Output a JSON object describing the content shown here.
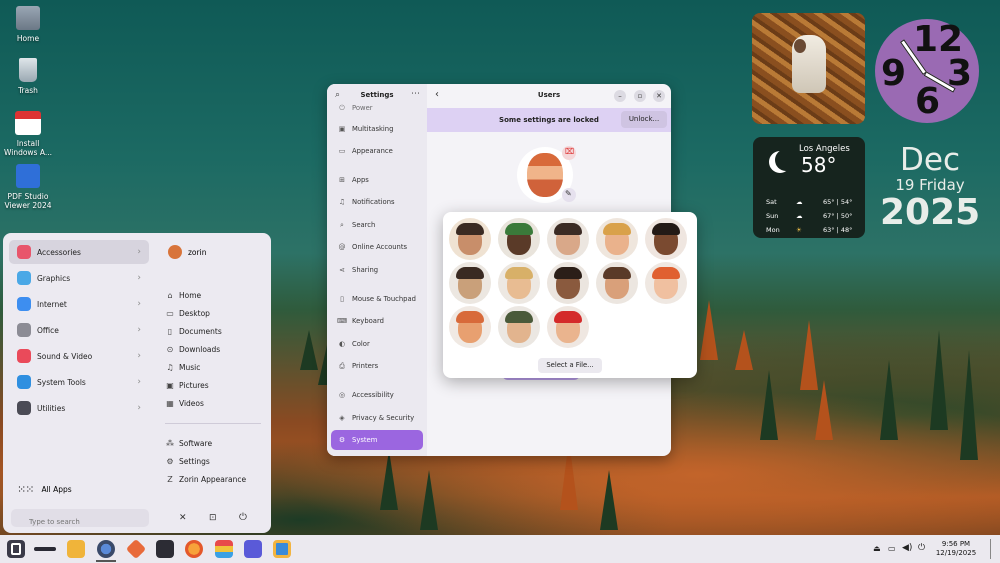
{
  "desktop": {
    "icons": [
      {
        "label": "Home"
      },
      {
        "label": "Trash"
      },
      {
        "label": "Install Windows A..."
      },
      {
        "label": "PDF Studio Viewer 2024"
      }
    ]
  },
  "widgets": {
    "clock": {
      "n12": "12",
      "n3": "3",
      "n6": "6",
      "n9": "9"
    },
    "weather": {
      "city": "Los Angeles",
      "temp": "58°",
      "days": [
        {
          "day": "Sat",
          "hilo": "65° | 54°"
        },
        {
          "day": "Sun",
          "hilo": "67° | 50°"
        },
        {
          "day": "Mon",
          "hilo": "63° | 48°"
        }
      ]
    },
    "date": {
      "month": "Dec",
      "day_line": "19 Friday",
      "year": "2025"
    }
  },
  "start_menu": {
    "categories": [
      {
        "label": "Accessories",
        "color": "#e8556b"
      },
      {
        "label": "Graphics",
        "color": "#4aa8e6"
      },
      {
        "label": "Internet",
        "color": "#3d8ef0"
      },
      {
        "label": "Office",
        "color": "#8c8c95"
      },
      {
        "label": "Sound & Video",
        "color": "#ea4a5a"
      },
      {
        "label": "System Tools",
        "color": "#2f8fe0"
      },
      {
        "label": "Utilities",
        "color": "#4b4b55"
      }
    ],
    "user": "zorin",
    "places": [
      "Home",
      "Desktop",
      "Documents",
      "Downloads",
      "Music",
      "Pictures",
      "Videos"
    ],
    "system_links": [
      "Software",
      "Settings",
      "Zorin Appearance"
    ],
    "all_apps": "All Apps",
    "search_placeholder": "Type to search"
  },
  "settings": {
    "sidebar_title": "Settings",
    "page_title": "Users",
    "locked_banner": "Some settings are locked",
    "unlock": "Unlock...",
    "sidebar": [
      "Power",
      "Multitasking",
      "Appearance",
      "Apps",
      "Notifications",
      "Search",
      "Online Accounts",
      "Sharing",
      "Mouse & Touchpad",
      "Keyboard",
      "Color",
      "Printers",
      "Accessibility",
      "Privacy & Security",
      "System"
    ],
    "selected": "System",
    "accent": "#9b66e0"
  },
  "avatar_picker": {
    "select_file": "Select a File..."
  },
  "taskbar": {
    "time": "9:56 PM",
    "date": "12/19/2025"
  }
}
